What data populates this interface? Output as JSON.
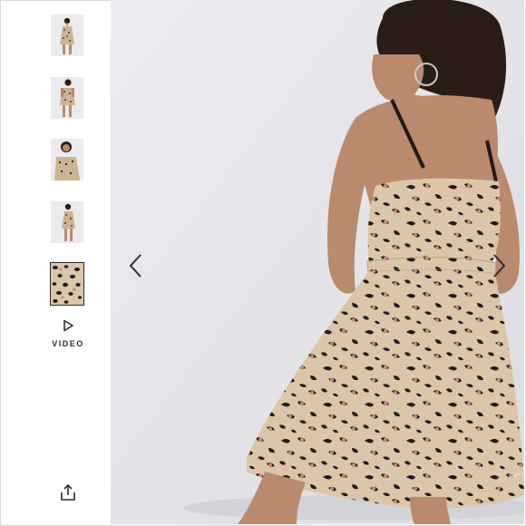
{
  "gallery": {
    "thumbnails": [
      {
        "name": "front-view",
        "active": false
      },
      {
        "name": "back-view",
        "active": false
      },
      {
        "name": "close-up-view",
        "active": false
      },
      {
        "name": "side-view",
        "active": false
      },
      {
        "name": "print-detail",
        "active": true
      }
    ],
    "video_label": "VIDEO",
    "icons": {
      "play": "play-icon",
      "share": "share-icon",
      "prev": "chevron-left-icon",
      "next": "chevron-right-icon"
    }
  },
  "colors": {
    "background": "#e4e4e8",
    "print_base": "#dcc6a8",
    "print_spot": "#1e1a17",
    "print_blush": "#c48a78",
    "skin": "#b98a6c",
    "hair": "#2a1d16",
    "icon": "#2d2d2d"
  }
}
